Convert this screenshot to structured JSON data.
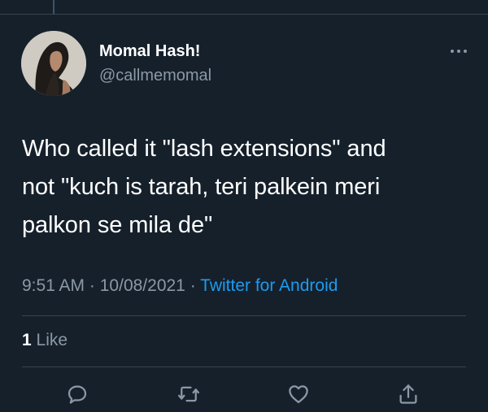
{
  "tweet": {
    "author_name": "Momal Hash!",
    "author_handle": "@callmemomal",
    "text_lines": [
      "Who called it \"lash extensions\" and",
      "not \"kuch is tarah, teri palkein meri",
      "palkon se mila de\""
    ],
    "time": "9:51 AM",
    "date": "10/08/2021",
    "separator": "·",
    "source": "Twitter for Android",
    "like_count": "1",
    "like_label": "Like"
  },
  "icons": {
    "more": "more-horizontal-icon",
    "reply": "reply-icon",
    "retweet": "retweet-icon",
    "like": "heart-icon",
    "share": "share-icon"
  },
  "colors": {
    "background": "#15202b",
    "text_primary": "#ffffff",
    "text_secondary": "#8b98a5",
    "link": "#1d9bf0",
    "divider": "#38444d"
  }
}
